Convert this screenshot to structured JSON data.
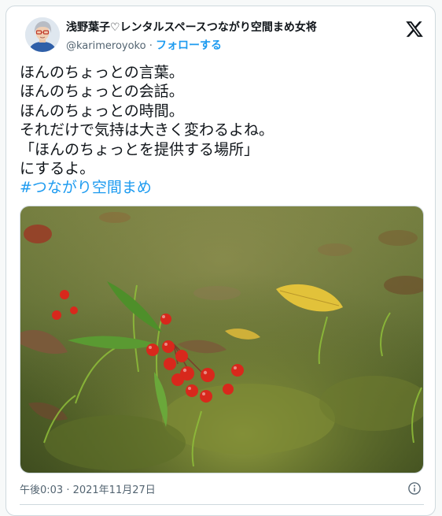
{
  "tweet": {
    "author": {
      "display_name": "浅野葉子♡レンタルスペースつながり空間まめ女将",
      "handle": "@karimeroyoko",
      "separator": "·",
      "follow_label": "フォローする"
    },
    "brand_icon": "x-logo-icon",
    "text_lines": [
      "ほんのちょっとの言葉。",
      "ほんのちょっとの会話。",
      "ほんのちょっとの時間。",
      "それだけで気持は大きく変わるよね。",
      "「ほんのちょっとを提供する場所」",
      "にするよ。"
    ],
    "hashtag": "#つながり空間まめ",
    "photo": {
      "subject_icon": "photo-red-berries-on-moss"
    },
    "timestamp": "午後0:03 · 2021年11月27日",
    "info_icon": "info-icon"
  },
  "colors": {
    "text": "#0f1419",
    "secondary": "#536471",
    "accent": "#1d9bf0",
    "border": "#cfd9de"
  }
}
